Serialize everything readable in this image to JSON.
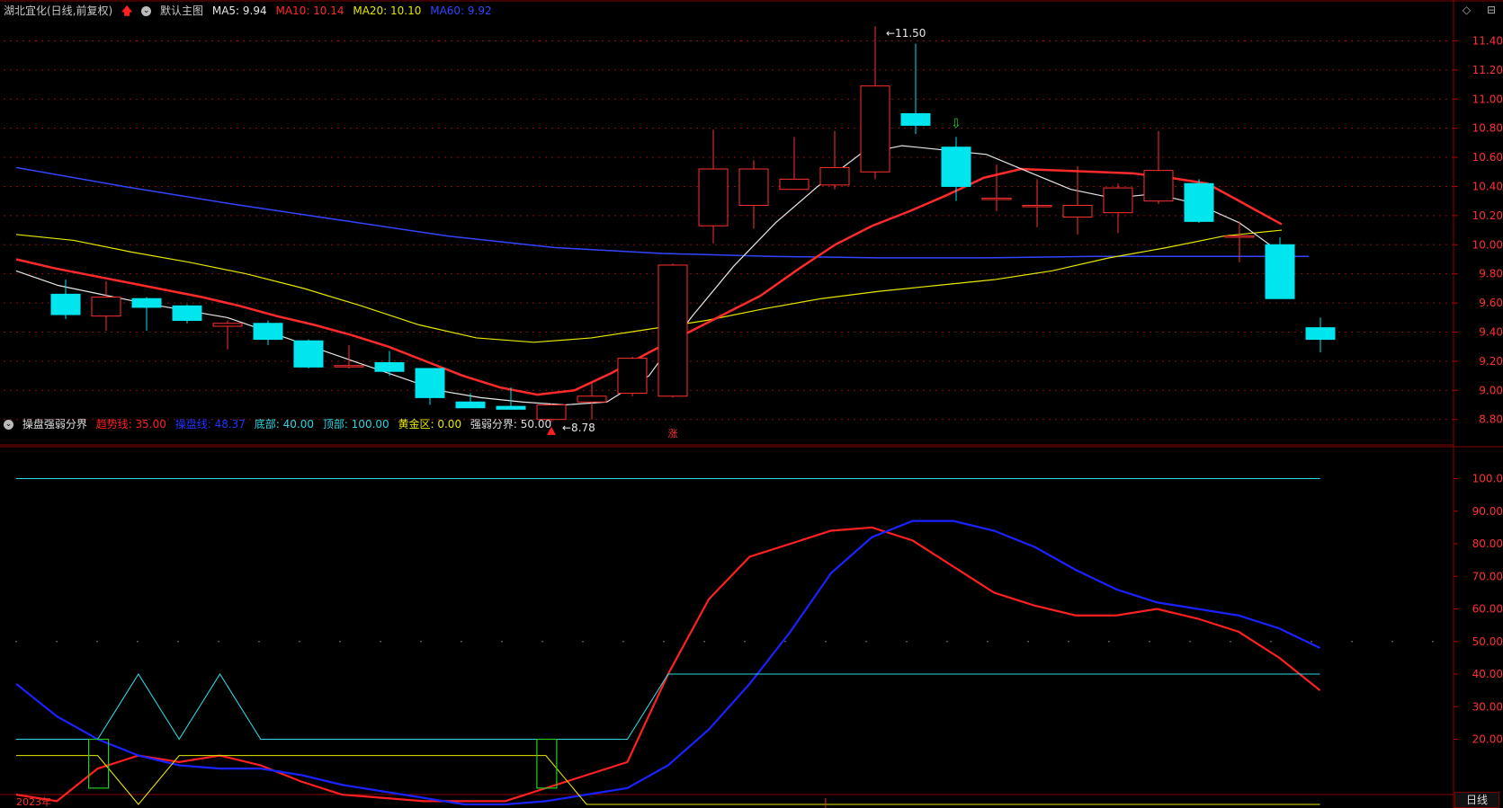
{
  "header": {
    "title": "湖北宜化(日线,前复权)",
    "main_indicator": "默认主图",
    "ma5": "MA5: 9.94",
    "ma10": "MA10: 10.14",
    "ma20": "MA20: 10.10",
    "ma60": "MA60: 9.92",
    "colors": {
      "ma5": "#e6e6e6",
      "ma10": "#ff2a2a",
      "ma20": "#e6e600",
      "ma60": "#3344ff"
    }
  },
  "sub_header": {
    "name": "操盘强弱分界",
    "trend": "趋势线: 35.00",
    "control": "操盘线: 48.37",
    "bottom": "底部: 40.00",
    "top": "顶部: 100.00",
    "gold": "黄金区: 0.00",
    "divide": "强弱分界: 50.00"
  },
  "top_right_icons": [
    "diamond-icon",
    "collapse-icon"
  ],
  "period_tab": "日线",
  "x_labels": {
    "year": "2023年",
    "month_marker": "|"
  },
  "chart_data": [
    {
      "type": "candlestick",
      "ylim": [
        8.65,
        11.52
      ],
      "yticks": [
        "11.40",
        "11.20",
        "11.00",
        "10.80",
        "10.60",
        "10.40",
        "10.20",
        "10.00",
        "9.80",
        "9.60",
        "9.40",
        "9.20",
        "9.00",
        "8.80"
      ],
      "candles": [
        {
          "o": 9.66,
          "h": 9.76,
          "l": 9.49,
          "c": 9.52
        },
        {
          "o": 9.51,
          "h": 9.75,
          "l": 9.41,
          "c": 9.64
        },
        {
          "o": 9.63,
          "h": 9.64,
          "l": 9.41,
          "c": 9.57
        },
        {
          "o": 9.58,
          "h": 9.59,
          "l": 9.46,
          "c": 9.48
        },
        {
          "o": 9.44,
          "h": 9.48,
          "l": 9.28,
          "c": 9.46
        },
        {
          "o": 9.46,
          "h": 9.48,
          "l": 9.31,
          "c": 9.35
        },
        {
          "o": 9.34,
          "h": 9.35,
          "l": 9.15,
          "c": 9.16
        },
        {
          "o": 9.17,
          "h": 9.31,
          "l": 9.15,
          "c": 9.17
        },
        {
          "o": 9.19,
          "h": 9.27,
          "l": 9.1,
          "c": 9.13
        },
        {
          "o": 9.15,
          "h": 9.15,
          "l": 8.9,
          "c": 8.95
        },
        {
          "o": 8.92,
          "h": 8.98,
          "l": 8.88,
          "c": 8.88
        },
        {
          "o": 8.89,
          "h": 9.02,
          "l": 8.87,
          "c": 8.87
        },
        {
          "o": 8.8,
          "h": 8.91,
          "l": 8.78,
          "c": 8.9
        },
        {
          "o": 8.92,
          "h": 9.05,
          "l": 8.8,
          "c": 8.96
        },
        {
          "o": 8.98,
          "h": 9.23,
          "l": 8.96,
          "c": 9.22
        },
        {
          "o": 8.96,
          "h": 9.87,
          "l": 8.95,
          "c": 9.86
        },
        {
          "o": 10.13,
          "h": 10.79,
          "l": 10.01,
          "c": 10.52
        },
        {
          "o": 10.27,
          "h": 10.58,
          "l": 10.11,
          "c": 10.52
        },
        {
          "o": 10.38,
          "h": 10.74,
          "l": 10.38,
          "c": 10.45
        },
        {
          "o": 10.41,
          "h": 10.78,
          "l": 10.38,
          "c": 10.53
        },
        {
          "o": 10.5,
          "h": 11.5,
          "l": 10.45,
          "c": 11.09
        },
        {
          "o": 10.9,
          "h": 11.38,
          "l": 10.76,
          "c": 10.82
        },
        {
          "o": 10.67,
          "h": 10.74,
          "l": 10.3,
          "c": 10.4
        },
        {
          "o": 10.31,
          "h": 10.55,
          "l": 10.23,
          "c": 10.32
        },
        {
          "o": 10.27,
          "h": 10.45,
          "l": 10.12,
          "c": 10.27
        },
        {
          "o": 10.19,
          "h": 10.54,
          "l": 10.07,
          "c": 10.27
        },
        {
          "o": 10.22,
          "h": 10.42,
          "l": 10.08,
          "c": 10.39
        },
        {
          "o": 10.3,
          "h": 10.78,
          "l": 10.28,
          "c": 10.51
        },
        {
          "o": 10.42,
          "h": 10.45,
          "l": 10.15,
          "c": 10.16
        },
        {
          "o": 10.06,
          "h": 10.16,
          "l": 9.88,
          "c": 10.06
        },
        {
          "o": 10.0,
          "h": 10.05,
          "l": 9.63,
          "c": 9.63
        },
        {
          "o": 9.43,
          "h": 9.5,
          "l": 9.26,
          "c": 9.35
        }
      ],
      "ma5": [
        9.82,
        9.72,
        9.66,
        9.6,
        9.55,
        9.5,
        9.4,
        9.3,
        9.2,
        9.1,
        9.0,
        8.95,
        8.92,
        8.9,
        8.92,
        9.1,
        9.5,
        9.85,
        10.15,
        10.4,
        10.62,
        10.68,
        10.65,
        10.62,
        10.5,
        10.38,
        10.32,
        10.35,
        10.28,
        10.15,
        9.94
      ],
      "ma10": [
        9.9,
        9.84,
        9.79,
        9.74,
        9.69,
        9.64,
        9.58,
        9.51,
        9.45,
        9.38,
        9.3,
        9.2,
        9.1,
        9.02,
        8.97,
        9.0,
        9.12,
        9.26,
        9.39,
        9.52,
        9.65,
        9.83,
        10.0,
        10.13,
        10.23,
        10.34,
        10.46,
        10.52,
        10.51,
        10.5,
        10.49,
        10.46,
        10.42,
        10.28,
        10.14
      ],
      "ma20": [
        10.07,
        10.03,
        9.95,
        9.88,
        9.8,
        9.7,
        9.58,
        9.45,
        9.36,
        9.33,
        9.36,
        9.42,
        9.48,
        9.56,
        9.63,
        9.68,
        9.72,
        9.76,
        9.82,
        9.91,
        9.98,
        10.06,
        10.1
      ],
      "ma60": [
        10.53,
        10.4,
        10.28,
        10.17,
        10.06,
        9.98,
        9.94,
        9.92,
        9.91,
        9.91,
        9.92,
        9.92,
        9.92
      ],
      "annotations": {
        "high": "11.50",
        "low": "8.78",
        "zhang": "涨"
      }
    },
    {
      "type": "line",
      "ylim": [
        -8,
        104
      ],
      "yticks": [
        "100.0",
        "90.00",
        "80.00",
        "70.00",
        "60.00",
        "50.00",
        "40.00",
        "30.00",
        "20.00"
      ],
      "series": [
        {
          "name": "趋势线",
          "color": "#ff2020",
          "values": [
            3,
            1,
            11,
            15,
            13,
            15,
            12,
            7,
            3,
            2,
            1,
            1,
            1,
            5,
            9,
            13,
            40,
            63,
            76,
            80,
            84,
            85,
            81,
            73,
            65,
            61,
            58,
            58,
            60,
            57,
            53,
            45,
            35
          ]
        },
        {
          "name": "操盘线",
          "color": "#1a22ff",
          "values": [
            37,
            27,
            20,
            15,
            12,
            11,
            11,
            9,
            6,
            4,
            2,
            0,
            0,
            1,
            3,
            5,
            12,
            23,
            37,
            53,
            71,
            82,
            87,
            87,
            84,
            79,
            72,
            66,
            62,
            60,
            58,
            54,
            48
          ]
        },
        {
          "name": "顶部",
          "color": "#2ad6e0",
          "values": [
            100,
            100
          ]
        },
        {
          "name": "底部",
          "color": "#2ad6e0",
          "values": [
            20,
            20,
            20,
            40,
            20,
            40,
            20,
            20,
            20,
            20,
            20,
            20,
            20,
            20,
            20,
            20,
            40,
            40,
            40,
            40,
            40,
            40,
            40,
            40,
            40,
            40,
            40,
            40,
            40,
            40,
            40,
            40,
            40
          ]
        },
        {
          "name": "强弱分界",
          "color": "#e6e600",
          "values": [
            15,
            15,
            15,
            0,
            15,
            15,
            15,
            15,
            15,
            15,
            15,
            15,
            15,
            15,
            0,
            0,
            0,
            0,
            0,
            0,
            0,
            0,
            0,
            0,
            0,
            0,
            0,
            0,
            0,
            0,
            0,
            0,
            0
          ]
        }
      ],
      "green_boxes": [
        [
          2,
          20,
          5
        ],
        [
          13,
          20,
          5
        ]
      ]
    }
  ]
}
